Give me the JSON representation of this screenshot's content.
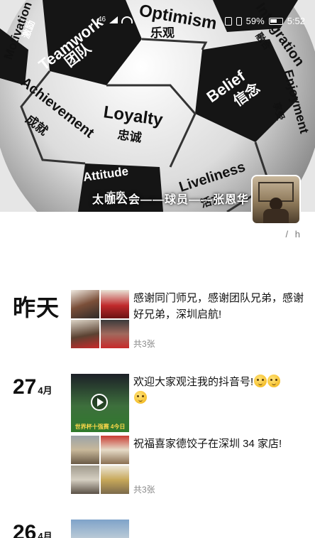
{
  "status_bar": {
    "signal_left": "46",
    "battery_percent": "59%",
    "time": "5:52"
  },
  "cover": {
    "ball_words": [
      "Teamwork",
      "团队",
      "Optimism",
      "乐观",
      "Loyalty",
      "忠诚",
      "Belief",
      "信念",
      "Achievement",
      "成就",
      "Motivation",
      "激励",
      "Liveliness",
      "活力",
      "Enjoyment",
      "享受",
      "Attitude",
      "态度",
      "Integration",
      "融合"
    ],
    "profile_name": "太咖公会——球员——张恩华",
    "signature_icon": "slash-signature-icon"
  },
  "feed": {
    "posts": [
      {
        "date_label": "昨天",
        "text": "感谢同门师兄，感谢团队兄弟，感谢好兄弟，深圳启航!",
        "count": "共3张"
      },
      {
        "date_day": "27",
        "date_month": "4月",
        "text": "欢迎大家观注我的抖音号!",
        "video_caption": "世界杯十强赛 4今日"
      },
      {
        "text": "祝福喜家德饺子在深圳 34 家店!",
        "count": "共3张"
      },
      {
        "date_day": "26",
        "date_month": "4月"
      }
    ]
  }
}
